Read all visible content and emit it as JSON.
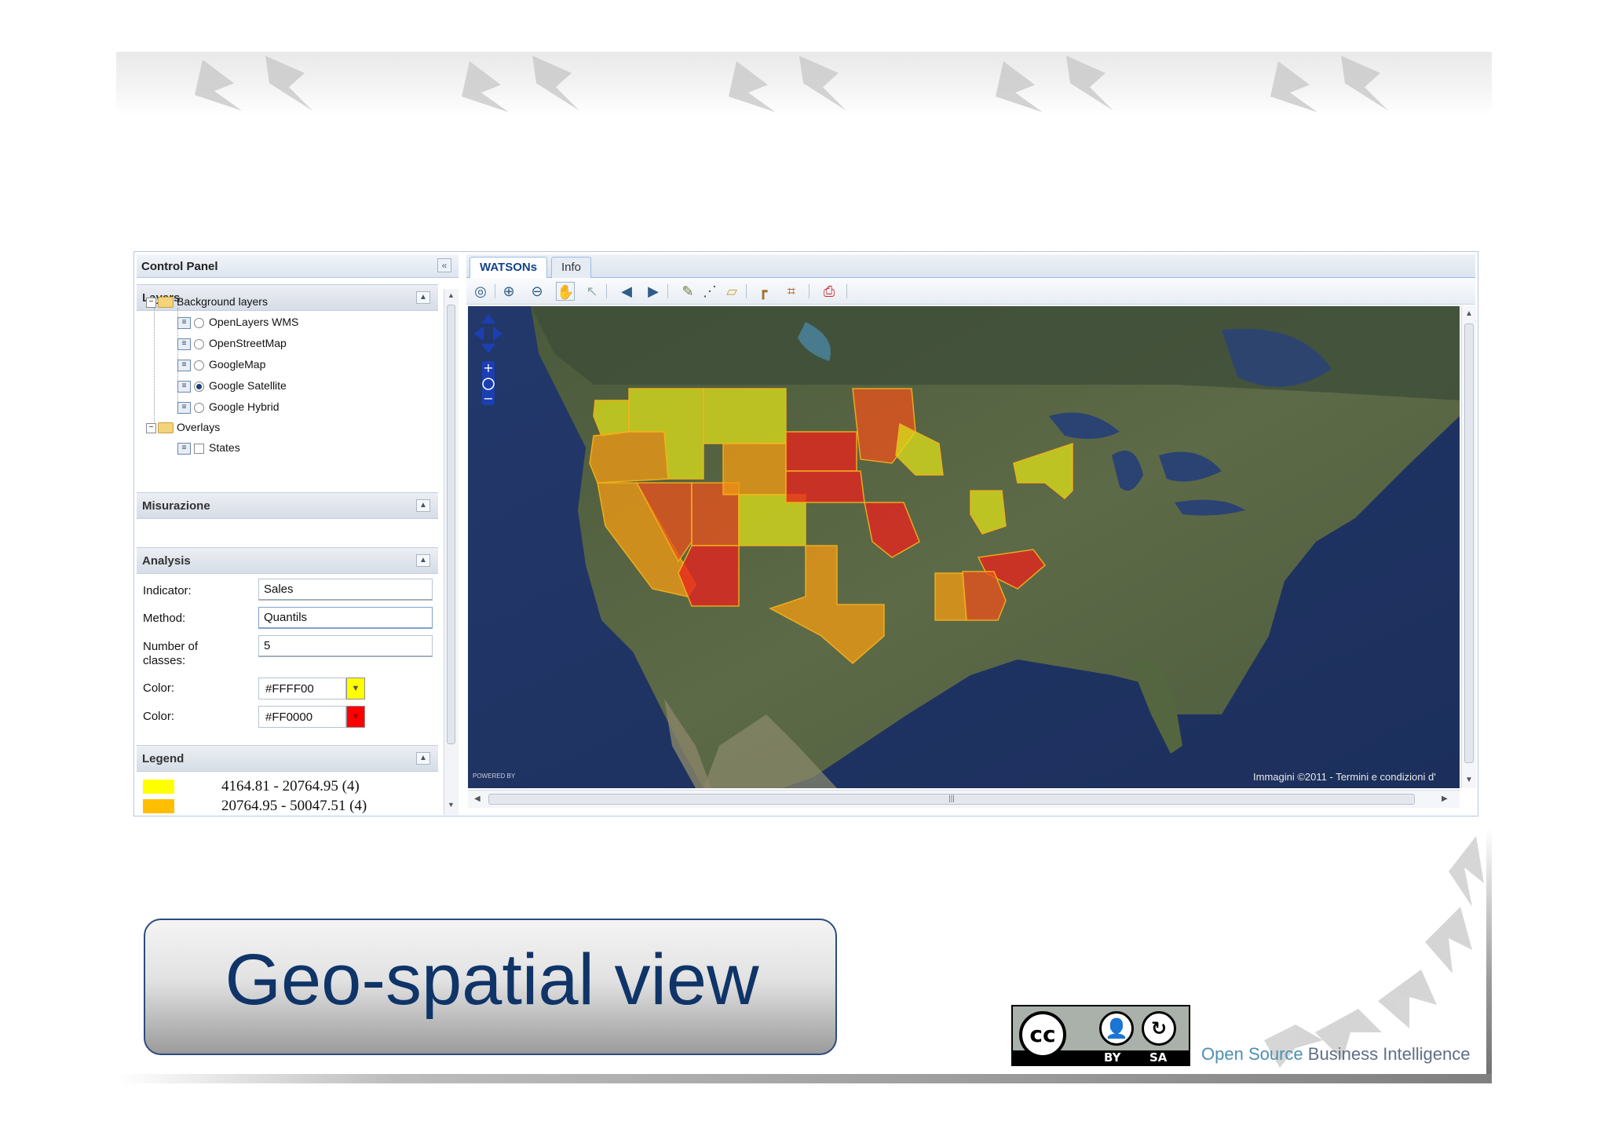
{
  "app": {
    "control_panel": {
      "title": "Control Panel",
      "sections": {
        "layers": "Layers",
        "measure": "Misurazione",
        "analysis": "Analysis",
        "legend": "Legend"
      },
      "tree": {
        "background_group": "Background layers",
        "background_layers": [
          {
            "label": "OpenLayers WMS",
            "selected": false
          },
          {
            "label": "OpenStreetMap",
            "selected": false
          },
          {
            "label": "GoogleMap",
            "selected": false
          },
          {
            "label": "Google Satellite",
            "selected": true
          },
          {
            "label": "Google Hybrid",
            "selected": false
          }
        ],
        "overlay_group": "Overlays",
        "overlay_layers": [
          {
            "label": "States",
            "checked": false
          }
        ]
      },
      "analysis": {
        "indicator_label": "Indicator:",
        "indicator_value": "Sales",
        "method_label": "Method:",
        "method_value": "Quantils",
        "classes_label": "Number of classes:",
        "classes_value": "5",
        "color1_label": "Color:",
        "color1_value": "#FFFF00",
        "color2_label": "Color:",
        "color2_value": "#FF0000"
      },
      "legend": [
        {
          "range": "4164.81 - 20764.95 (4)",
          "color": "#ffff00"
        },
        {
          "range": "20764.95 - 50047.51 (4)",
          "color": "#ffbf00"
        }
      ]
    },
    "map_panel": {
      "tabs": [
        {
          "label": "WATSONs",
          "active": true
        },
        {
          "label": "Info",
          "active": false
        }
      ],
      "toolbar_icons": [
        "zoom-extent-icon",
        "zoom-in-icon",
        "zoom-out-icon",
        "pan-hand-icon",
        "select-arrow-icon",
        "previous-extent-icon",
        "next-extent-icon",
        "draw-pencil-icon",
        "measure-line-icon",
        "measure-area-icon",
        "query-icon",
        "crop-icon",
        "print-icon"
      ],
      "copyright": "Immagini ©2011 - Termini e condizioni d'",
      "powered_by": "POWERED BY"
    }
  },
  "slide": {
    "title": "Geo-spatial view",
    "license": {
      "cc": "cc",
      "by": "BY",
      "sa": "SA"
    },
    "footer_brand": {
      "word1": "Open",
      "word2": "Source",
      "word3": "Business",
      "word4": "Intelligence"
    }
  },
  "colors": {
    "title_text": "#0f3468",
    "state_yellow": "#d9dc1a",
    "state_orange": "#f09a14",
    "state_red": "#e8241e",
    "tab_active_text": "#15428b"
  }
}
